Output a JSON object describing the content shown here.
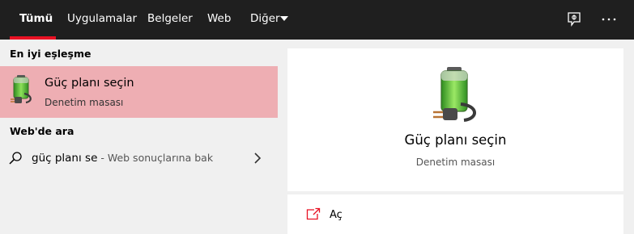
{
  "tabs": [
    {
      "label": "Tümü",
      "active": true
    },
    {
      "label": "Uygulamalar"
    },
    {
      "label": "Belgeler"
    },
    {
      "label": "Web"
    },
    {
      "label": "Diğer"
    }
  ],
  "accent_color": "#e81123",
  "best_match_highlight": "#eeaeb3",
  "top_icons": [
    "feedback-icon",
    "more-options-icon"
  ],
  "left": {
    "best_match_header": "En iyi eşleşme",
    "best_match": {
      "title": "Güç planı seçin",
      "subtitle": "Denetim masası",
      "icon": "battery-power-icon"
    },
    "web_header": "Web'de ara",
    "web_result": {
      "query": "güç planı se",
      "hint": " - Web sonuçlarına bak",
      "icon": "search-icon"
    }
  },
  "right": {
    "title": "Güç planı seçin",
    "subtitle": "Denetim masası",
    "icon": "battery-power-icon",
    "actions": [
      {
        "label": "Aç",
        "icon": "open-icon"
      }
    ]
  }
}
